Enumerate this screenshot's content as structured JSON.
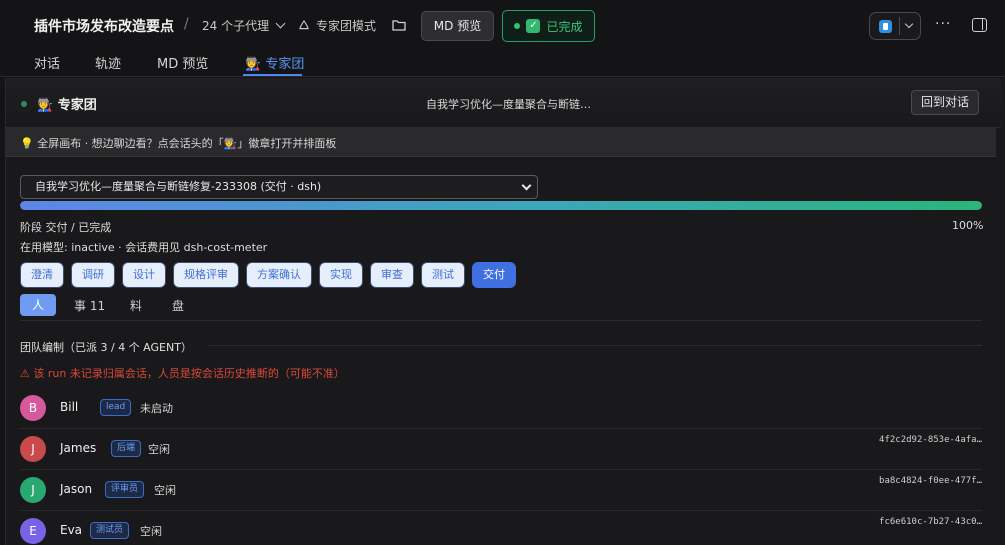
{
  "header": {
    "title": "插件市场发布改造要点",
    "separator": "/",
    "agents_label": "24 个子代理",
    "expert_mode_label": "专家团模式",
    "md_preview_button": "MD 预览",
    "status_button": "已完成",
    "check_glyph": "✓",
    "more_glyph": "···"
  },
  "tabs": [
    {
      "label": "对话"
    },
    {
      "label": "轨迹"
    },
    {
      "label": "MD 预览"
    },
    {
      "label": "🧑‍🏭 专家团",
      "active": true
    }
  ],
  "panel": {
    "title": "🧑‍🏭 专家团",
    "subtitle": "自我学习优化—度量聚合与断链…",
    "back_button": "回到对话",
    "tip": "💡 全屏画布 · 想边聊边看？点会话头的「🧑‍🏭」徽章打开并排面板",
    "run_select_value": "自我学习优化—度量聚合与断链修复-233308 (交付 · dsh)",
    "progress_percent": 100,
    "progress_label": "100%",
    "stage_text": "阶段 交付 / 已完成",
    "model_text": "在用模型: inactive · 会话费用见 dsh-cost-meter",
    "phases": [
      "澄清",
      "调研",
      "设计",
      "规格评审",
      "方案确认",
      "实现",
      "审查",
      "测试",
      "交付"
    ],
    "active_phase": "交付",
    "subtabs": [
      "人",
      "事 11",
      "料",
      "盘"
    ],
    "team_heading": "团队编制（已派 3 / 4 个 AGENT）",
    "warning": "⚠ 该 run 未记录归属会话，人员是按会话历史推断的（可能不准）",
    "members": [
      {
        "initial": "B",
        "name": "Bill",
        "role": "lead",
        "status": "未启动",
        "id": "",
        "color": "#d6599c"
      },
      {
        "initial": "J",
        "name": "James",
        "role": "后端",
        "status": "空闲",
        "id": "4f2c2d92-853e-4afa…",
        "color": "#c84a4a"
      },
      {
        "initial": "J",
        "name": "Jason",
        "role": "评审员",
        "status": "空闲",
        "id": "ba8c4824-f0ee-477f…",
        "color": "#2aa871"
      },
      {
        "initial": "E",
        "name": "Eva",
        "role": "测试员",
        "status": "空闲",
        "id": "fc6e610c-7b27-43c0…",
        "color": "#7a62e6"
      }
    ]
  }
}
